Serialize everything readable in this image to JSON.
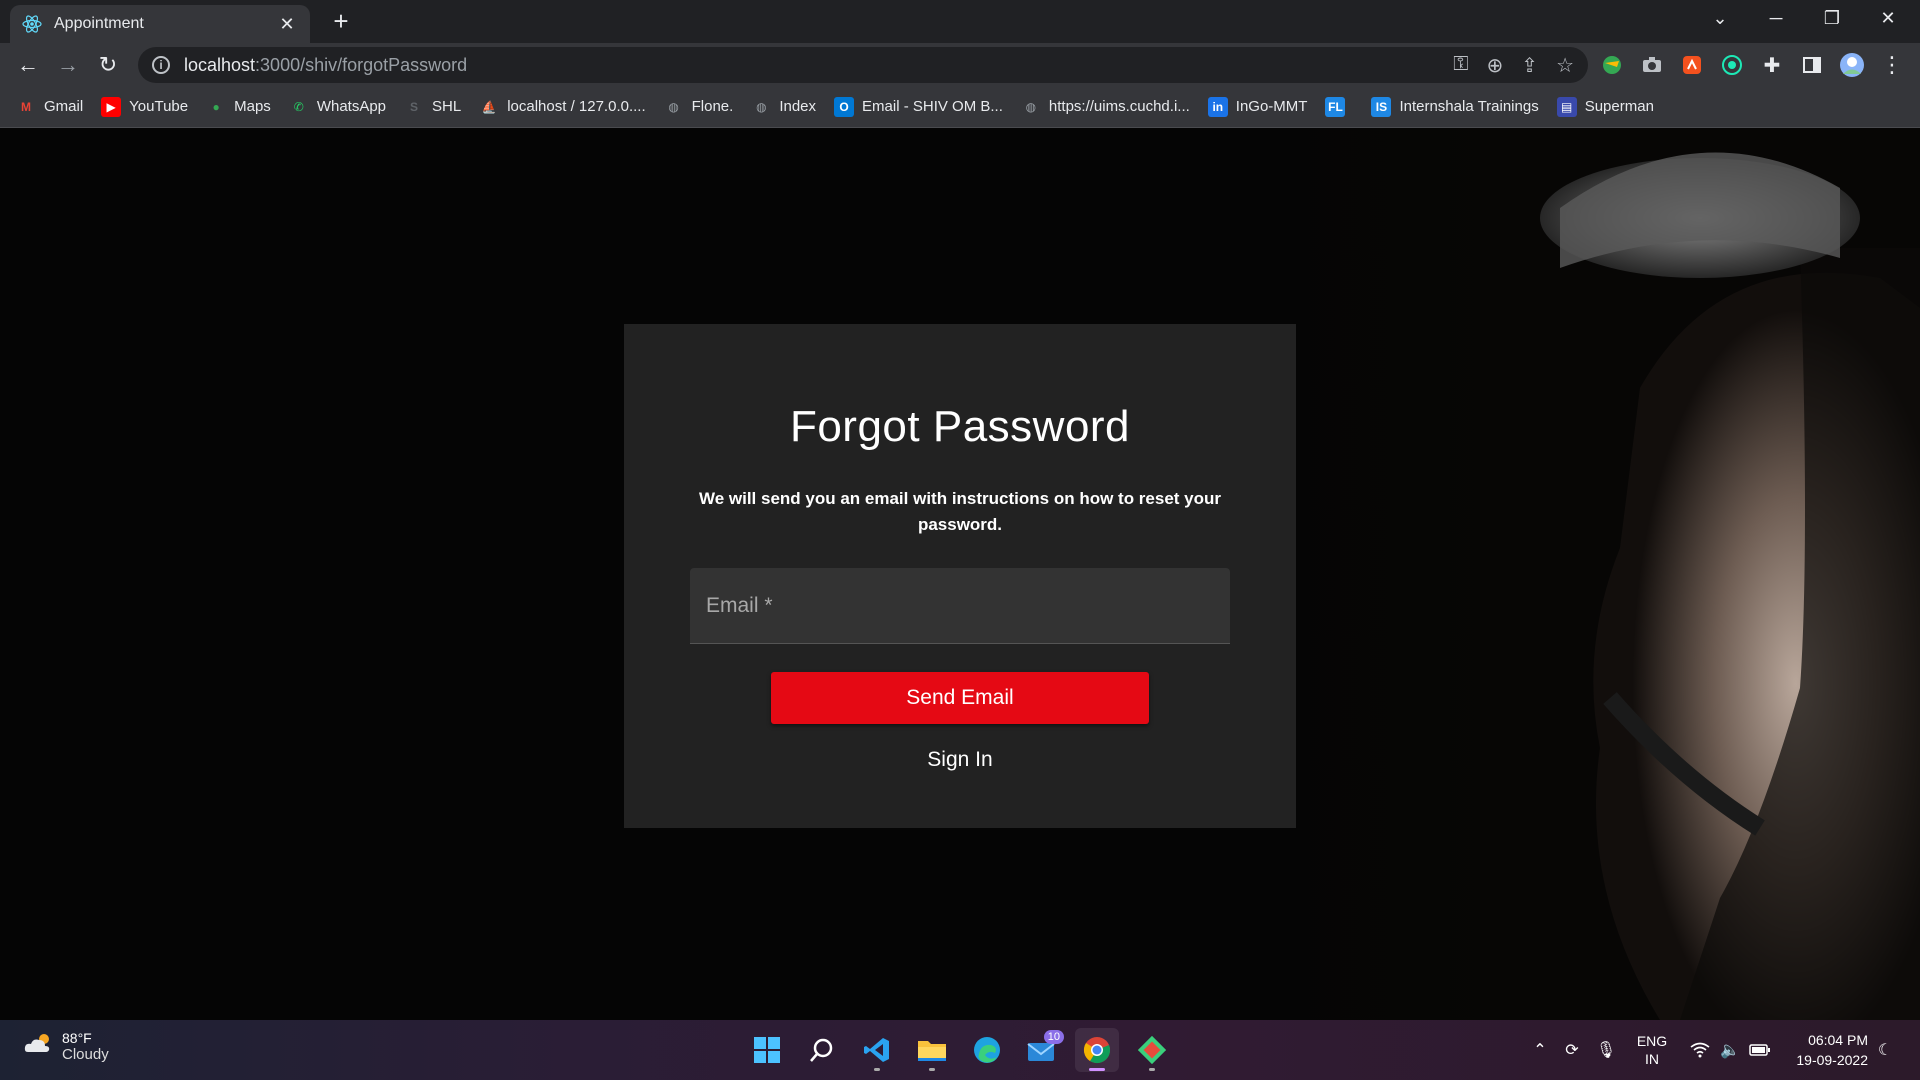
{
  "browser": {
    "tab_title": "Appointment",
    "url_host": "localhost",
    "url_path": ":3000/shiv/forgotPassword"
  },
  "bookmarks": [
    {
      "label": "Gmail",
      "icon": "gmail-icon",
      "color": "#ea4335"
    },
    {
      "label": "YouTube",
      "icon": "youtube-icon",
      "color": "#ff0000"
    },
    {
      "label": "Maps",
      "icon": "maps-icon",
      "color": "#34a853"
    },
    {
      "label": "WhatsApp",
      "icon": "whatsapp-icon",
      "color": "#25d366"
    },
    {
      "label": "SHL",
      "icon": "shl-icon",
      "color": "#5f6368"
    },
    {
      "label": "localhost / 127.0.0....",
      "icon": "phpmyadmin-icon",
      "color": "#f89c0e"
    },
    {
      "label": "Flone.",
      "icon": "globe-icon",
      "color": "#9aa0a6"
    },
    {
      "label": "Index",
      "icon": "globe-icon",
      "color": "#9aa0a6"
    },
    {
      "label": "Email - SHIV OM B...",
      "icon": "outlook-icon",
      "color": "#0078d4"
    },
    {
      "label": "https://uims.cuchd.i...",
      "icon": "globe-icon",
      "color": "#9aa0a6"
    },
    {
      "label": "InGo-MMT",
      "icon": "ingo-icon",
      "color": "#1a73e8"
    },
    {
      "label": "",
      "icon": "fl-icon",
      "color": "#1e88e5"
    },
    {
      "label": "Internshala Trainings",
      "icon": "internshala-icon",
      "color": "#1e88e5"
    },
    {
      "label": "Superman",
      "icon": "superman-icon",
      "color": "#3949ab"
    }
  ],
  "card": {
    "title": "Forgot Password",
    "description": "We will send you an email with instructions on how to reset your password.",
    "email_placeholder": "Email *",
    "send_button": "Send Email",
    "signin_link": "Sign In"
  },
  "colors": {
    "accent": "#e50914",
    "card_bg": "#222222",
    "page_bg": "#050505"
  },
  "taskbar": {
    "weather_temp": "88°F",
    "weather_cond": "Cloudy",
    "mail_badge": "10",
    "lang_top": "ENG",
    "lang_bottom": "IN",
    "time": "06:04 PM",
    "date": "19-09-2022"
  }
}
